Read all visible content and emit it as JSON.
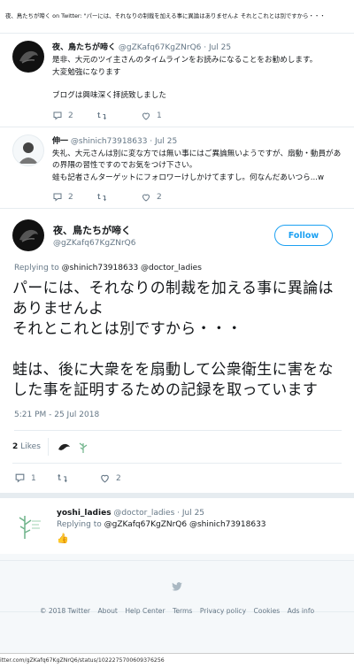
{
  "page_title": "夜、鳥たちが啼く on Twitter: \"パーには、それなりの制裁を加える事に異論はありませんよ それとこれとは別ですから・・・",
  "tweets": [
    {
      "name": "夜、鳥たちが啼く",
      "meta": "@gZKafq67KgZNrQ6 · Jul 25",
      "lines": [
        "是非、大元のツイ主さんのタイムラインをお読みになることをお勧めします。",
        "大変勉強になります",
        "",
        "ブログは興味深く拝読致しました"
      ],
      "reply_count": "2",
      "retweet_count": "",
      "like_count": "1"
    },
    {
      "name": "伸一",
      "meta": "@shinich73918633 · Jul 25",
      "lines": [
        "失礼、大元さんは別に変な方では無い事にはご異論無いようですが、扇動・動員があの界隈の習性ですのでお気をつけ下さい。",
        "蛙も記者さんターゲットにフォロワーけしかけてますし。何なんだあいつら...w"
      ],
      "reply_count": "2",
      "retweet_count": "",
      "like_count": "2"
    }
  ],
  "main_tweet": {
    "name": "夜、鳥たちが啼く",
    "handle": "@gZKafq67KgZNrQ6",
    "follow_label": "Follow",
    "replying_prefix": "Replying to ",
    "replying_to": "@shinich73918633 @doctor_ladies",
    "lines": [
      "パーには、それなりの制裁を加える事に異論はありませんよ",
      "それとこれとは別ですから・・・",
      "",
      "蛙は、後に大衆をを扇動して公衆衛生に害をなした事を証明するための記録を取っています"
    ],
    "timestamp": "5:21 PM - 25 Jul 2018",
    "likes_count": "2",
    "likes_label": "Likes",
    "reply_count": "1",
    "retweet_count": "",
    "like_count": "2"
  },
  "reply": {
    "name": "yoshi_ladies",
    "meta": "@doctor_ladies · Jul 25",
    "replying_prefix": "Replying to ",
    "replying_to": "@gZKafq67KgZNrQ6 @shinich73918633",
    "emoji": "👍"
  },
  "footer": {
    "links": [
      "© 2018 Twitter",
      "About",
      "Help Center",
      "Terms",
      "Privacy policy",
      "Cookies",
      "Ads info"
    ]
  },
  "status_url": "itter.com/gZKafq67KgZNrQ6/status/1022275700609376256",
  "colors": {
    "accent": "#1da1f2",
    "muted": "#657786",
    "text": "#14171a"
  },
  "icons": [
    "reply-icon",
    "retweet-icon",
    "heart-icon",
    "twitter-bird-icon"
  ]
}
